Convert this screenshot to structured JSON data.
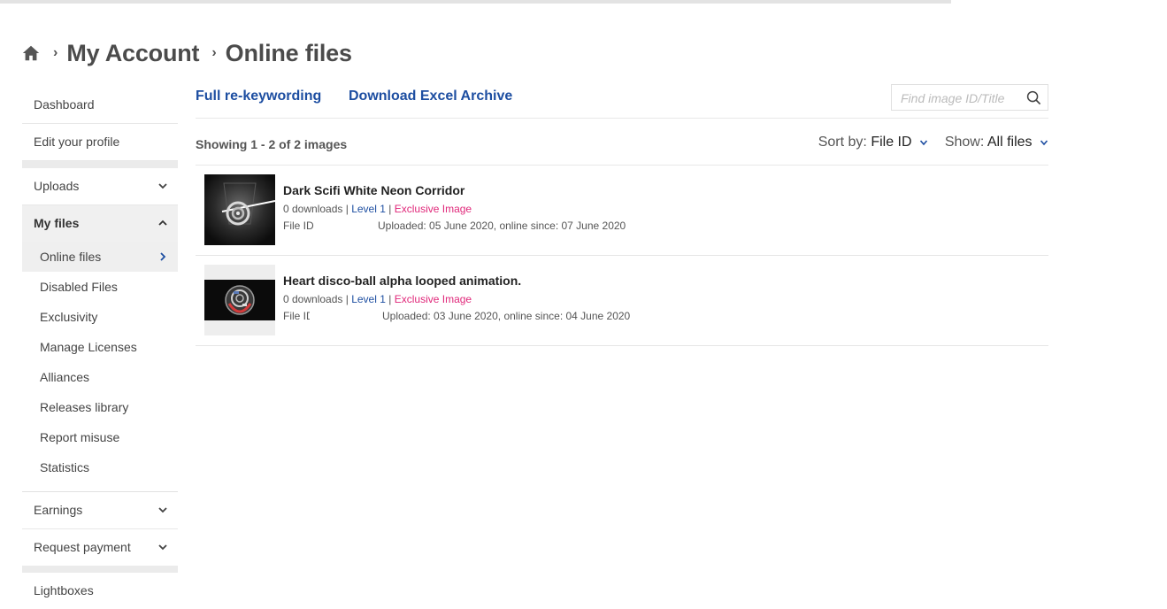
{
  "breadcrumb": {
    "home_icon": "home-icon",
    "items": [
      "My Account",
      "Online files"
    ]
  },
  "sidebar": {
    "dashboard": "Dashboard",
    "edit_profile": "Edit your profile",
    "uploads": "Uploads",
    "my_files": "My files",
    "sub": [
      "Online files",
      "Disabled Files",
      "Exclusivity",
      "Manage Licenses",
      "Alliances",
      "Releases library",
      "Report misuse",
      "Statistics"
    ],
    "earnings": "Earnings",
    "request_payment": "Request payment",
    "lightboxes": "Lightboxes"
  },
  "toolbar": {
    "rekeyword": "Full re-keywording",
    "excel": "Download Excel Archive",
    "search_placeholder": "Find image ID/Title"
  },
  "listhead": {
    "showing": "Showing 1 - 2 of 2 images",
    "sort_label": "Sort by:",
    "sort_value": "File ID",
    "show_label": "Show:",
    "show_value": "All files"
  },
  "files": [
    {
      "title": "Dark Scifi White Neon Corridor",
      "downloads": "0 downloads",
      "sep1": "|",
      "level": "Level 1",
      "sep2": "|",
      "exclusive": "Exclusive Image",
      "file_id_label": "File ID",
      "uploaded": "Uploaded: 05 June 2020, online since: 07 June 2020"
    },
    {
      "title": "Heart disco-ball alpha looped animation.",
      "downloads": "0 downloads",
      "sep1": "|",
      "level": "Level 1",
      "sep2": "|",
      "exclusive": "Exclusive Image",
      "file_id_label": "File ID",
      "uploaded": "Uploaded: 03 June 2020, online since: 04 June 2020"
    }
  ],
  "colors": {
    "link": "#1d4ea1",
    "exclusive": "#e0287a",
    "sidebar_active": "#efefef"
  },
  "page_progress": 0.815
}
